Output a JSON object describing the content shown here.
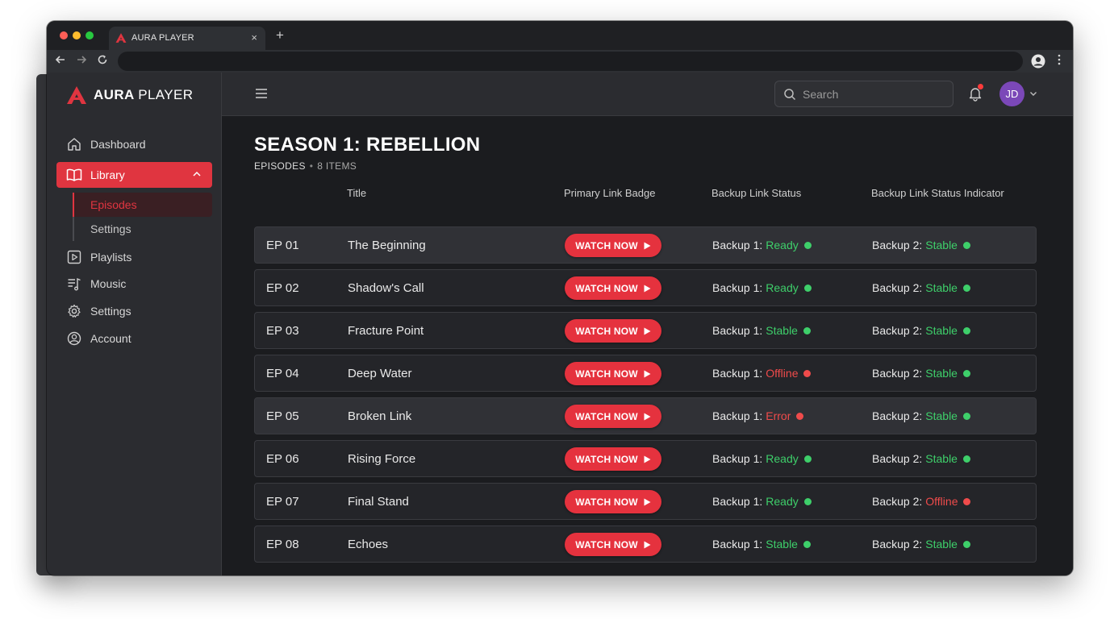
{
  "browser": {
    "tab_title": "AURA PLAYER",
    "tab_close": "×",
    "new_tab": "+"
  },
  "brand": {
    "name_bold": "AURA",
    "name_light": "PLAYER",
    "accent": "#e03540"
  },
  "sidebar": {
    "items": [
      {
        "label": "Dashboard",
        "icon": "home-icon"
      },
      {
        "label": "Library",
        "icon": "book-icon",
        "active": true
      },
      {
        "label": "Playlists",
        "icon": "play-square-icon"
      },
      {
        "label": "Mousic",
        "icon": "music-list-icon"
      },
      {
        "label": "Settings",
        "icon": "gear-icon"
      },
      {
        "label": "Account",
        "icon": "user-circle-icon"
      }
    ],
    "sub_items": [
      {
        "label": "Episodes",
        "active": true
      },
      {
        "label": "Settings"
      }
    ]
  },
  "header": {
    "search_placeholder": "Search",
    "avatar_initials": "JD"
  },
  "page": {
    "title": "SEASON 1: REBELLION",
    "section": "EPISODES",
    "count": "8 ITEMS"
  },
  "table": {
    "columns": [
      "Title",
      "Primary Link Badge",
      "Backup Link Status",
      "Backup Link Status Indicator"
    ],
    "button_label": "WATCH NOW",
    "backup1_prefix": "Backup 1:",
    "backup2_prefix": "Backup 2:",
    "rows": [
      {
        "ep": "EP 01",
        "title": "The Beginning",
        "b1": "Ready",
        "b1_ok": true,
        "b2": "Stable",
        "b2_ok": true,
        "highlight": true
      },
      {
        "ep": "EP 02",
        "title": "Shadow's Call",
        "b1": "Ready",
        "b1_ok": true,
        "b2": "Stable",
        "b2_ok": true
      },
      {
        "ep": "EP 03",
        "title": "Fracture Point",
        "b1": "Stable",
        "b1_ok": true,
        "b2": "Stable",
        "b2_ok": true
      },
      {
        "ep": "EP 04",
        "title": "Deep Water",
        "b1": "Offline",
        "b1_ok": false,
        "b2": "Stable",
        "b2_ok": true
      },
      {
        "ep": "EP 05",
        "title": "Broken Link",
        "b1": "Error",
        "b1_ok": false,
        "b2": "Stable",
        "b2_ok": true,
        "highlight": true
      },
      {
        "ep": "EP 06",
        "title": "Rising Force",
        "b1": "Ready",
        "b1_ok": true,
        "b2": "Stable",
        "b2_ok": true
      },
      {
        "ep": "EP 07",
        "title": "Final Stand",
        "b1": "Ready",
        "b1_ok": true,
        "b2": "Offline",
        "b2_ok": false
      },
      {
        "ep": "EP 08",
        "title": "Echoes",
        "b1": "Stable",
        "b1_ok": true,
        "b2": "Stable",
        "b2_ok": true
      }
    ]
  },
  "colors": {
    "ok": "#3ecf6a",
    "bad": "#ef4b4b",
    "button": "#e5323e"
  }
}
